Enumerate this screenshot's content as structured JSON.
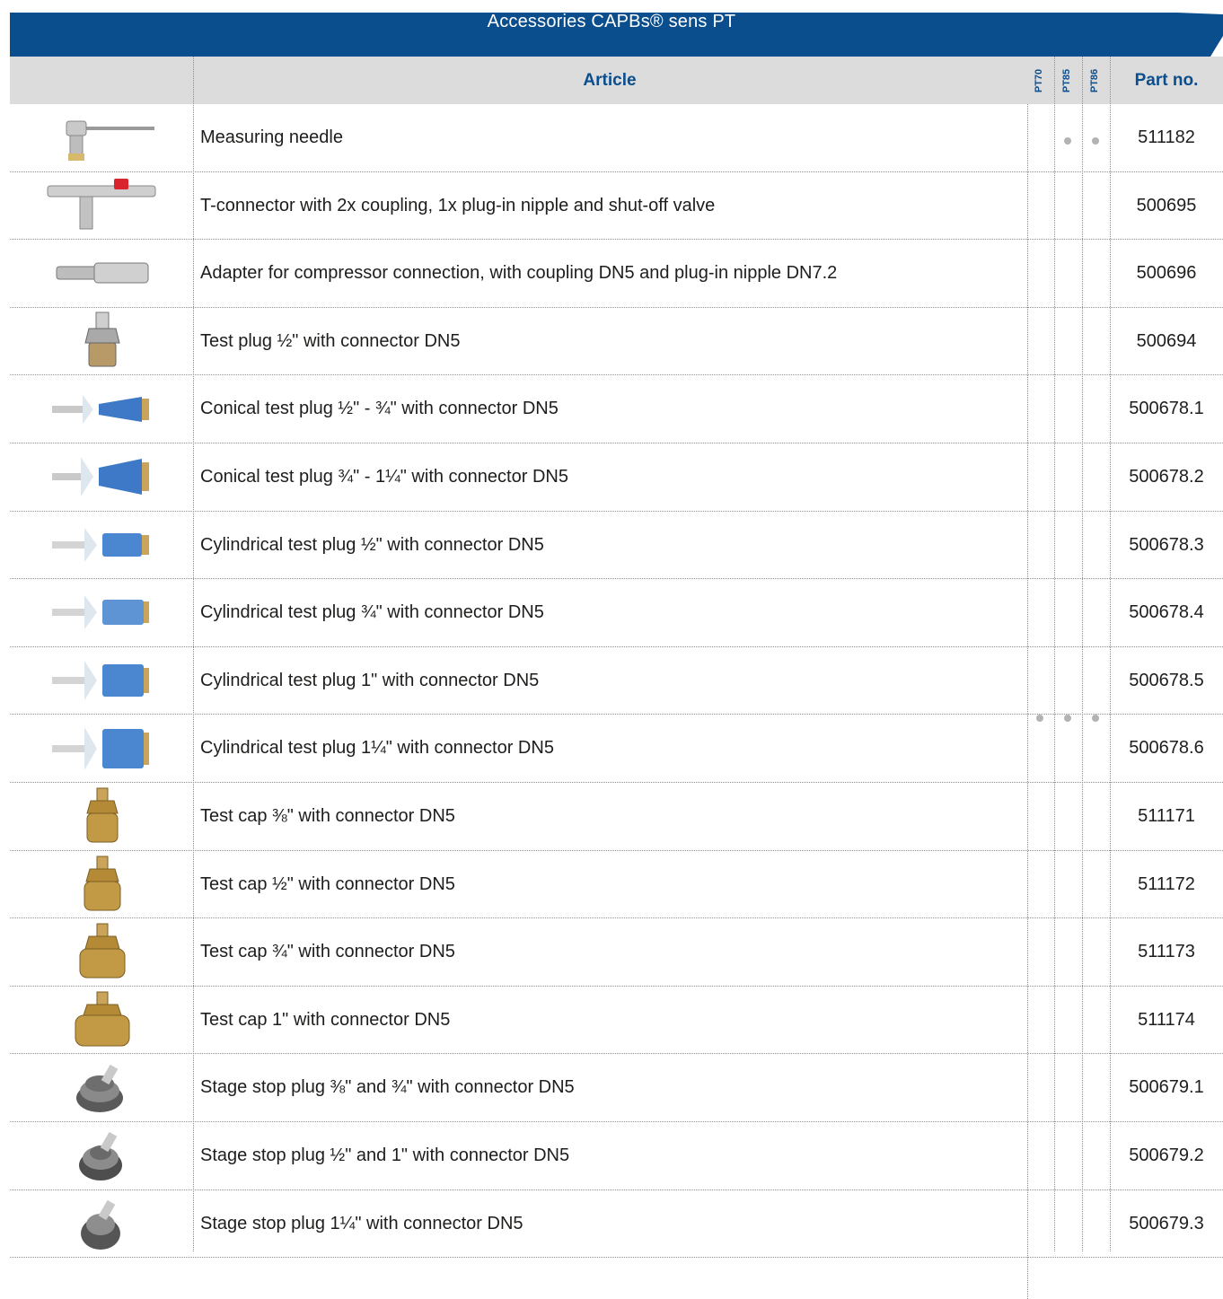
{
  "title": "Accessories CAPBs® sens PT",
  "columns": {
    "article": "Article",
    "models": [
      "PT70",
      "PT85",
      "PT86"
    ],
    "part_no": "Part no."
  },
  "rows": [
    {
      "article": "Measuring needle",
      "part_no": "511182",
      "icon": "measuring-needle"
    },
    {
      "article": "T-connector with 2x coupling, 1x plug-in nipple and shut-off valve",
      "part_no": "500695",
      "icon": "t-connector"
    },
    {
      "article": "Adapter for compressor connection, with coupling DN5 and plug-in nipple DN7.2",
      "part_no": "500696",
      "icon": "adapter"
    },
    {
      "article": "Test plug ½\" with connector DN5",
      "part_no": "500694",
      "icon": "test-plug"
    },
    {
      "article": "Conical test plug ½\" - ¾\" with connector DN5",
      "part_no": "500678.1",
      "icon": "conical-plug"
    },
    {
      "article": "Conical test plug ¾\" - 1¼\" with connector DN5",
      "part_no": "500678.2",
      "icon": "conical-plug"
    },
    {
      "article": "Cylindrical test plug ½\" with connector DN5",
      "part_no": "500678.3",
      "icon": "cylindrical-plug"
    },
    {
      "article": "Cylindrical test plug ¾\" with connector DN5",
      "part_no": "500678.4",
      "icon": "cylindrical-plug"
    },
    {
      "article": "Cylindrical test plug 1\" with connector DN5",
      "part_no": "500678.5",
      "icon": "cylindrical-plug"
    },
    {
      "article": "Cylindrical test plug 1¼\" with connector DN5",
      "part_no": "500678.6",
      "icon": "cylindrical-plug"
    },
    {
      "article": "Test cap ⅜\" with connector DN5",
      "part_no": "511171",
      "icon": "test-cap"
    },
    {
      "article": "Test cap ½\" with connector DN5",
      "part_no": "511172",
      "icon": "test-cap"
    },
    {
      "article": "Test cap ¾\" with connector DN5",
      "part_no": "511173",
      "icon": "test-cap"
    },
    {
      "article": "Test cap 1\" with connector DN5",
      "part_no": "511174",
      "icon": "test-cap"
    },
    {
      "article": "Stage stop plug ⅜\" and ¾\" with connector DN5",
      "part_no": "500679.1",
      "icon": "stage-stop-plug"
    },
    {
      "article": "Stage stop plug ½\" and 1\" with connector DN5",
      "part_no": "500679.2",
      "icon": "stage-stop-plug"
    },
    {
      "article": "Stage stop plug 1¼\" with connector DN5",
      "part_no": "500679.3",
      "icon": "stage-stop-plug"
    }
  ],
  "compatibility": [
    {
      "rows": "Measuring needle",
      "PT70": false,
      "PT85": true,
      "PT86": true
    },
    {
      "rows": "T-connector … Stage stop plug 1¼\"",
      "PT70": true,
      "PT85": true,
      "PT86": true
    }
  ],
  "colors": {
    "brand_blue": "#0b4e8e",
    "header_gray": "#dcdcdc",
    "dot_gray": "#b3b3b3"
  }
}
